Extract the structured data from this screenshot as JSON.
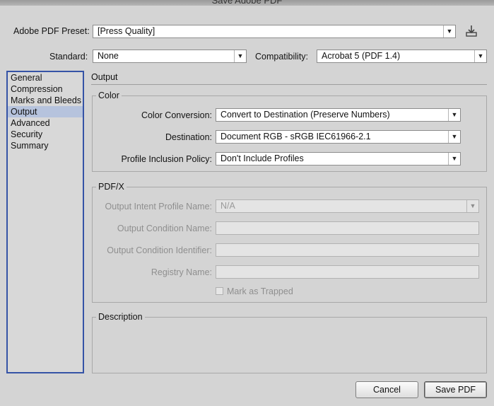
{
  "window": {
    "title": "Save Adobe PDF"
  },
  "preset": {
    "label": "Adobe PDF Preset:",
    "value": "[Press Quality]"
  },
  "standard": {
    "label": "Standard:",
    "value": "None"
  },
  "compatibility": {
    "label": "Compatibility:",
    "value": "Acrobat 5 (PDF 1.4)"
  },
  "sidebar": {
    "items": [
      {
        "label": "General"
      },
      {
        "label": "Compression"
      },
      {
        "label": "Marks and Bleeds"
      },
      {
        "label": "Output",
        "selected": true
      },
      {
        "label": "Advanced"
      },
      {
        "label": "Security"
      },
      {
        "label": "Summary"
      }
    ]
  },
  "panel": {
    "title": "Output"
  },
  "color": {
    "title": "Color",
    "conversion": {
      "label": "Color Conversion:",
      "value": "Convert to Destination (Preserve Numbers)"
    },
    "destination": {
      "label": "Destination:",
      "value": "Document RGB - sRGB IEC61966-2.1"
    },
    "profile_policy": {
      "label": "Profile Inclusion Policy:",
      "value": "Don't Include Profiles"
    }
  },
  "pdfx": {
    "title": "PDF/X",
    "intent_profile": {
      "label": "Output Intent Profile Name:",
      "value": "N/A"
    },
    "condition_name": {
      "label": "Output Condition Name:",
      "value": ""
    },
    "condition_identifier": {
      "label": "Output Condition Identifier:",
      "value": ""
    },
    "registry_name": {
      "label": "Registry Name:",
      "value": ""
    },
    "mark_trapped": {
      "label": "Mark as Trapped",
      "checked": false
    }
  },
  "description": {
    "title": "Description",
    "text": ""
  },
  "buttons": {
    "cancel": "Cancel",
    "save": "Save PDF"
  },
  "icons": {
    "save_preset": "save-preset-icon",
    "dropdown": "chevron-down-icon"
  },
  "colors": {
    "selection": "#b6c3dd",
    "focus_border": "#3553a6"
  }
}
